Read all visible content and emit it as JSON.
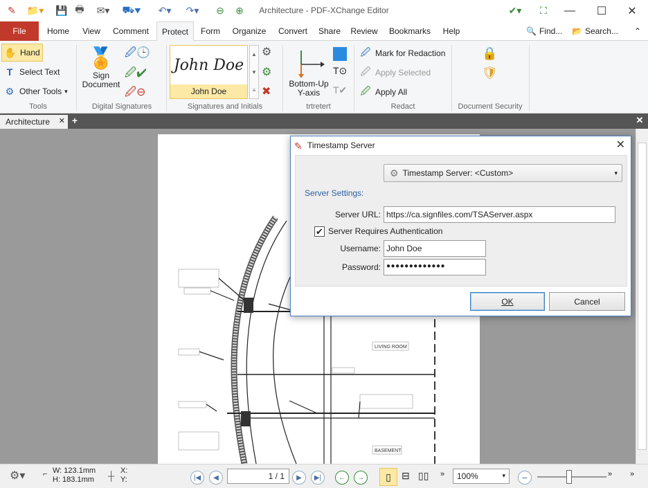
{
  "window": {
    "title": "Architecture - PDF-XChange Editor"
  },
  "menu": {
    "file": "File",
    "tabs": [
      "Home",
      "View",
      "Comment",
      "Protect",
      "Form",
      "Organize",
      "Convert",
      "Share",
      "Review",
      "Bookmarks",
      "Help"
    ],
    "active": "Protect",
    "find": "Find...",
    "search": "Search..."
  },
  "ribbon": {
    "tools": {
      "hand": "Hand",
      "select_text": "Select Text",
      "other_tools": "Other Tools",
      "label": "Tools"
    },
    "digital_signatures": {
      "sign_document_line1": "Sign",
      "sign_document_line2": "Document",
      "label": "Digital Signatures"
    },
    "signatures": {
      "sample_signature": "John Doe",
      "name": "John Doe",
      "label": "Signatures and Initials"
    },
    "trtretert": {
      "bottom_up_line1": "Bottom-Up",
      "bottom_up_line2": "Y-axis",
      "label": "trtretert"
    },
    "redact": {
      "mark": "Mark for Redaction",
      "apply_selected": "Apply Selected",
      "apply_all": "Apply All",
      "label": "Redact"
    },
    "security": {
      "label": "Document Security"
    }
  },
  "doc_tab": {
    "name": "Architecture"
  },
  "drawing_labels": {
    "living_room": "LIVING ROOM",
    "basement": "BASEMENT"
  },
  "status": {
    "width": "W: 123.1mm",
    "height": "H: 183.1mm",
    "x": "X:",
    "y": "Y:",
    "page": "1 / 1",
    "zoom": "100%"
  },
  "dialog": {
    "title": "Timestamp Server",
    "server_combo": "Timestamp Server:  <Custom>",
    "section": "Server Settings:",
    "url_label": "Server URL:",
    "url_value": "https://ca.signfiles.com/TSAServer.aspx",
    "auth_label": "Server Requires Authentication",
    "auth_checked": true,
    "username_label": "Username:",
    "username_value": "John Doe",
    "password_label": "Password:",
    "password_value": "●●●●●●●●●●●●●",
    "ok": "OK",
    "cancel": "Cancel"
  },
  "colors": {
    "file_tab": "#c0392b",
    "accent": "#4a7fc1",
    "signature_bg": "#fbe9a5"
  }
}
